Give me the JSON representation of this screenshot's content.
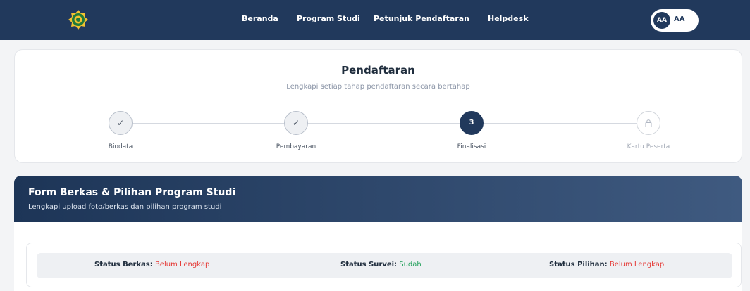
{
  "nav": {
    "links": [
      "Beranda",
      "Program Studi",
      "Petunjuk Pendaftaran",
      "Helpdesk"
    ],
    "user_initials": "AA",
    "user_name": "AA"
  },
  "registration": {
    "title": "Pendaftaran",
    "subtitle": "Lengkapi setiap tahap pendaftaran secara bertahap",
    "steps": [
      {
        "label": "Biodata",
        "marker": "✓",
        "state": "done"
      },
      {
        "label": "Pembayaran",
        "marker": "✓",
        "state": "done"
      },
      {
        "label": "Finalisasi",
        "marker": "3",
        "state": "active"
      },
      {
        "label": "Kartu Peserta",
        "marker": "lock-icon",
        "state": "locked"
      }
    ]
  },
  "form": {
    "title": "Form Berkas & Pilihan Program Studi",
    "subtitle": "Lengkapi upload foto/berkas dan pilihan program studi"
  },
  "status": {
    "berkas": {
      "label": "Status Berkas:",
      "value": "Belum Lengkap",
      "color": "#e53935"
    },
    "survei": {
      "label": "Status Survei:",
      "value": "Sudah",
      "color": "#22a05b"
    },
    "pilihan": {
      "label": "Status Pilihan:",
      "value": "Belum Lengkap",
      "color": "#e53935"
    }
  },
  "colors": {
    "brand": "#21395c",
    "danger": "#e53935",
    "success": "#22a05b"
  }
}
